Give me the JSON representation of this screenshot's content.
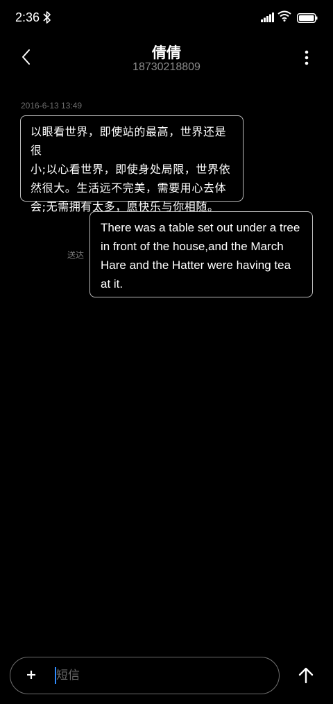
{
  "status_bar": {
    "time": "2:36",
    "icons": [
      "bluetooth-icon",
      "signal-icon",
      "wifi-icon",
      "battery-icon"
    ]
  },
  "header": {
    "contact_name": "倩倩",
    "contact_number": "18730218809",
    "back_icon": "chevron-left-icon",
    "more_icon": "more-vertical-icon"
  },
  "conversation": {
    "timestamp": "2016-6-13 13:49",
    "messages": [
      {
        "direction": "incoming",
        "text_lines": [
          "以眼看世界，即使站的最高，世界还是很",
          "小;以心看世界，即使身处局限，世界依",
          "然很大。生活远不完美，需要用心去体",
          "会;无需拥有太多，愿快乐与你相随。"
        ]
      },
      {
        "direction": "outgoing",
        "status": "送达",
        "text_lines": [
          "There was a table set out under a tree",
          "in front of the house,and the March",
          "Hare and the Hatter were having tea",
          "at it."
        ]
      }
    ]
  },
  "composer": {
    "placeholder": "短信",
    "value": "",
    "add_icon": "plus-icon",
    "send_icon": "arrow-up-icon"
  },
  "colors": {
    "background": "#000000",
    "bubble_border": "#bdbdbd",
    "secondary_text": "#8a8a8a",
    "cursor": "#2f8cff"
  }
}
